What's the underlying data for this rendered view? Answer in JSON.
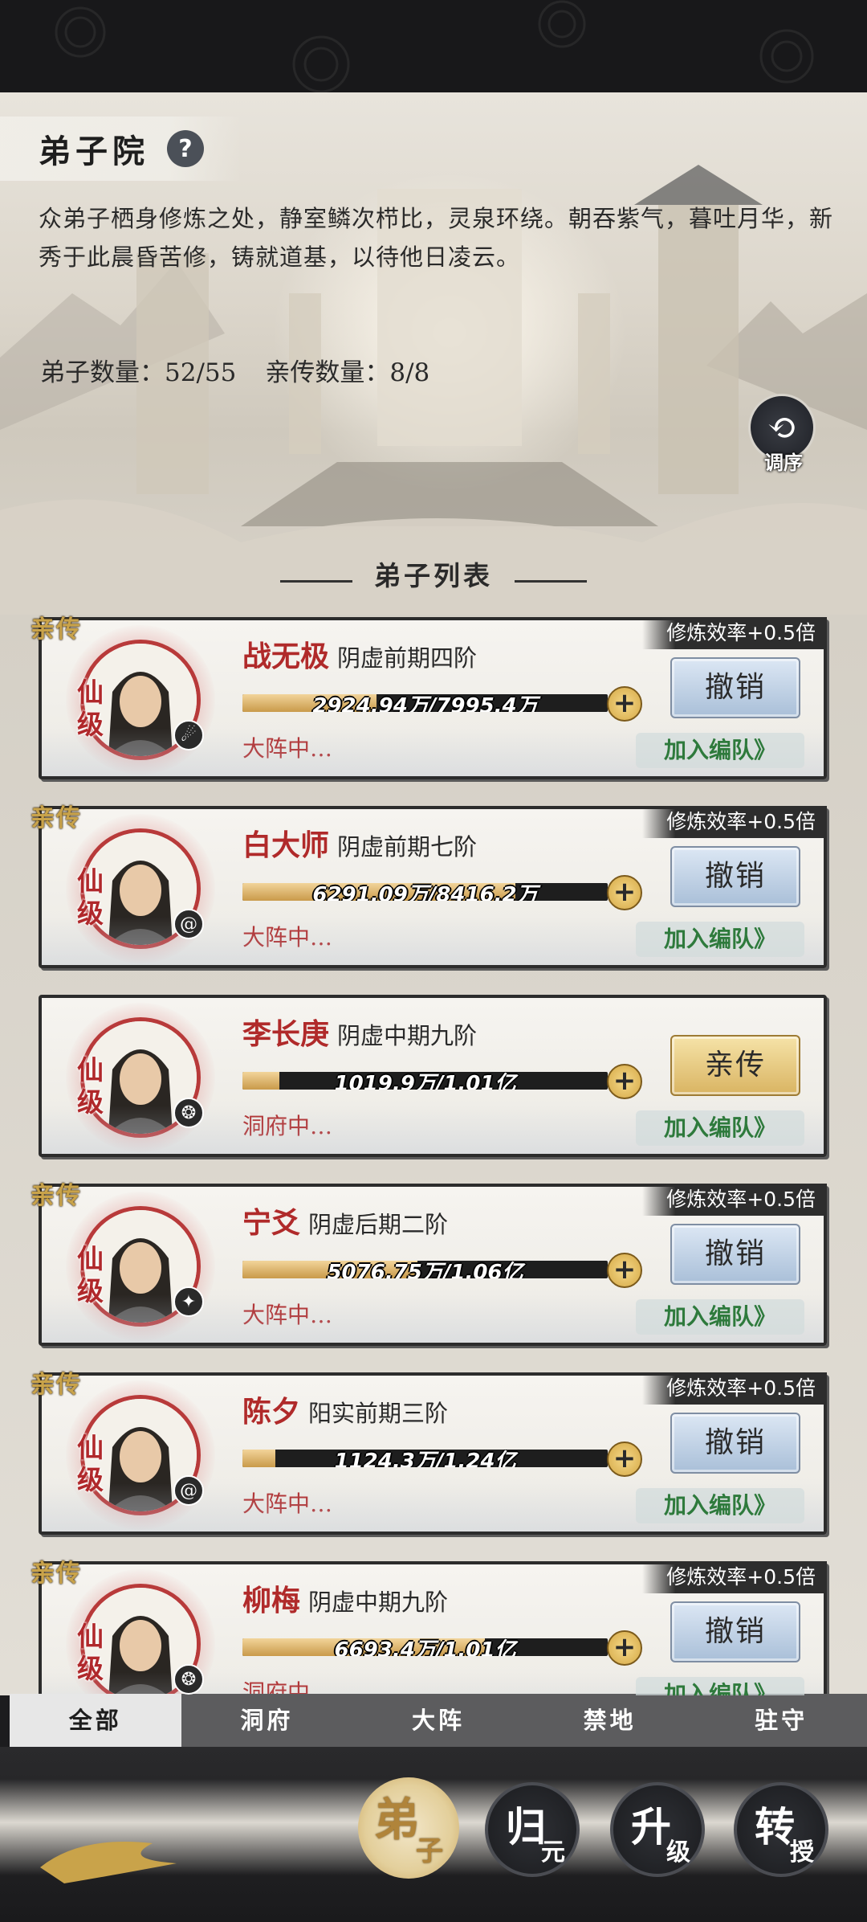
{
  "header": {
    "title": "弟子院",
    "help_icon": "question-icon",
    "description": "众弟子栖身修炼之处，静室鳞次栉比，灵泉环绕。朝吞紫气，暮吐月华，新秀于此晨昏苦修，铸就道基，以待他日凌云。",
    "disciple_count": "弟子数量：52/55",
    "direct_count": "亲传数量：8/8",
    "sort_label": "调序"
  },
  "section_title": "弟子列表",
  "disciples": [
    {
      "name": "战无极",
      "realm": "阴虚前期四阶",
      "exp": "2924.94万/7995.4万",
      "progress": 0.366,
      "location": "大阵中…",
      "badge": "亲传",
      "efficiency": "修炼效率+0.5倍",
      "rank": "仙级",
      "action": "撤销",
      "team": "加入编队》",
      "element_icon": "fire-icon"
    },
    {
      "name": "白大师",
      "realm": "阴虚前期七阶",
      "exp": "6291.09万/8416.2万",
      "progress": 0.747,
      "location": "大阵中…",
      "badge": "亲传",
      "efficiency": "修炼效率+0.5倍",
      "rank": "仙级",
      "action": "撤销",
      "team": "加入编队》",
      "element_icon": "swirl-icon"
    },
    {
      "name": "李长庚",
      "realm": "阴虚中期九阶",
      "exp": "1019.9万/1.01亿",
      "progress": 0.1,
      "location": "洞府中…",
      "badge": "",
      "efficiency": "",
      "rank": "仙级",
      "action": "亲传",
      "team": "加入编队》",
      "element_icon": "wind-icon"
    },
    {
      "name": "宁爻",
      "realm": "阴虚后期二阶",
      "exp": "5076.75万/1.06亿",
      "progress": 0.479,
      "location": "大阵中…",
      "badge": "亲传",
      "efficiency": "修炼效率+0.5倍",
      "rank": "仙级",
      "action": "撤销",
      "team": "加入编队》",
      "element_icon": "ice-icon"
    },
    {
      "name": "陈夕",
      "realm": "阳实前期三阶",
      "exp": "1124.3万/1.24亿",
      "progress": 0.09,
      "location": "大阵中…",
      "badge": "亲传",
      "efficiency": "修炼效率+0.5倍",
      "rank": "仙级",
      "action": "撤销",
      "team": "加入编队》",
      "element_icon": "swirl-icon"
    },
    {
      "name": "柳梅",
      "realm": "阴虚中期九阶",
      "exp": "6693.4万/1.01亿",
      "progress": 0.663,
      "location": "洞府中…",
      "badge": "亲传",
      "efficiency": "修炼效率+0.5倍",
      "rank": "仙级",
      "action": "撤销",
      "team": "加入编队》",
      "element_icon": "wind-icon"
    }
  ],
  "tabs": [
    "全部",
    "洞府",
    "大阵",
    "禁地",
    "驻守"
  ],
  "active_tab": "全部",
  "bottom_nav": [
    {
      "main": "弟",
      "sub": "子",
      "active": true
    },
    {
      "main": "归",
      "sub": "元",
      "active": false
    },
    {
      "main": "升",
      "sub": "级",
      "active": false
    },
    {
      "main": "转",
      "sub": "授",
      "active": false
    }
  ],
  "colors": {
    "name_red": "#b02a2a",
    "team_green": "#2e7a3c",
    "badge_gold": "#c9a34a",
    "button_blue": "#a9bfd8",
    "button_gold": "#d9b462"
  }
}
